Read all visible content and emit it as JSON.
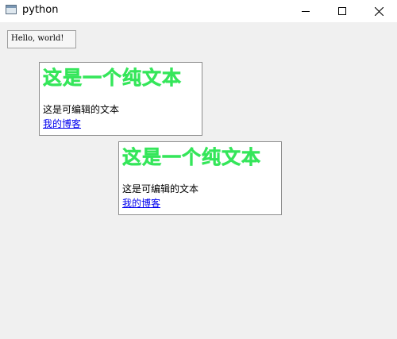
{
  "window": {
    "title": "python",
    "minimize_icon": "minimize-icon",
    "maximize_icon": "maximize-icon",
    "close_icon": "close-icon"
  },
  "hello_label": "Hello, world!",
  "rich_boxes": [
    {
      "heading": "这是一个纯文本",
      "text": "这是可编辑的文本",
      "link": "我的博客"
    },
    {
      "heading": "这是一个纯文本",
      "text": "这是可编辑的文本",
      "link": "我的博客"
    }
  ],
  "colors": {
    "heading": "#35e65a",
    "link": "#0000ee",
    "background": "#f0f0f0"
  }
}
